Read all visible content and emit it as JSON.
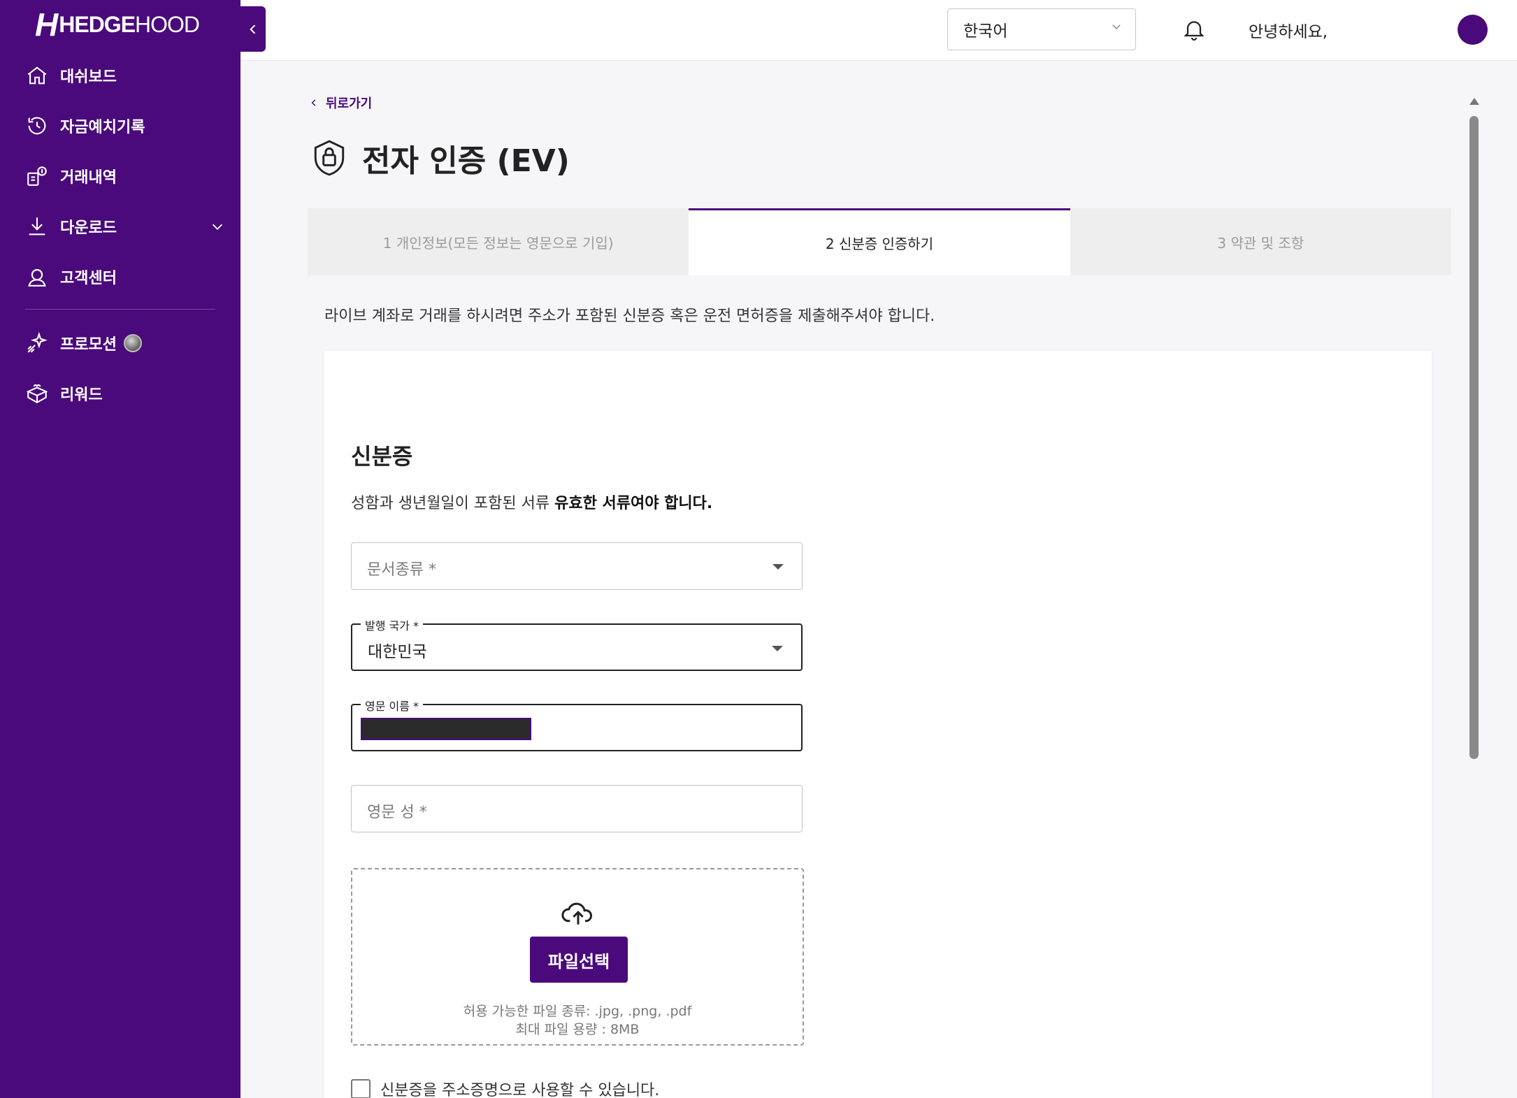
{
  "brand": {
    "mark": "H",
    "bold": "HEDGE",
    "light": "HOOD"
  },
  "sidebar": {
    "items": [
      {
        "label": "대쉬보드",
        "icon": "home-icon"
      },
      {
        "label": "자금예치기록",
        "icon": "history-icon"
      },
      {
        "label": "거래내역",
        "icon": "transactions-icon"
      },
      {
        "label": "다운로드",
        "icon": "download-icon",
        "expandable": true
      },
      {
        "label": "고객센터",
        "icon": "support-icon"
      }
    ],
    "items_secondary": [
      {
        "label": "프로모션",
        "icon": "sparkle-icon",
        "badge": "coin-badge"
      },
      {
        "label": "리워드",
        "icon": "gift-icon"
      }
    ]
  },
  "header": {
    "language": "한국어",
    "greeting": "안녕하세요,"
  },
  "page": {
    "back": "뒤로가기",
    "title": "전자 인증 (EV)",
    "tabs": [
      {
        "label": "1 개인정보(모든 정보는 영문으로 기입)",
        "active": false
      },
      {
        "label": "2 신분증 인증하기",
        "active": true
      },
      {
        "label": "3 약관 및 조항",
        "active": false
      }
    ],
    "intro": "라이브 계좌로 거래를 하시려면 주소가 포함된 신분증 혹은 운전 면허증을 제출해주셔야 합니다."
  },
  "card": {
    "title": "신분증",
    "sub_prefix": "성함과 생년월일이 포함된 서류",
    "sub_bold": "유효한 서류여야 합니다.",
    "doc_type_placeholder": "문서종류 *",
    "country_label": "발행 국가 *",
    "country_value": "대한민국",
    "first_name_label": "영문 이름 *",
    "last_name_placeholder": "영문 성 *",
    "upload_button": "파일선택",
    "upload_types": "허용 가능한 파일 종류: .jpg, .png, .pdf",
    "upload_size": "최대 파일 용량 : 8MB",
    "checkbox_label": "신분증을 주소증명으로 사용할 수 있습니다."
  },
  "colors": {
    "brand": "#4a0a7b"
  }
}
